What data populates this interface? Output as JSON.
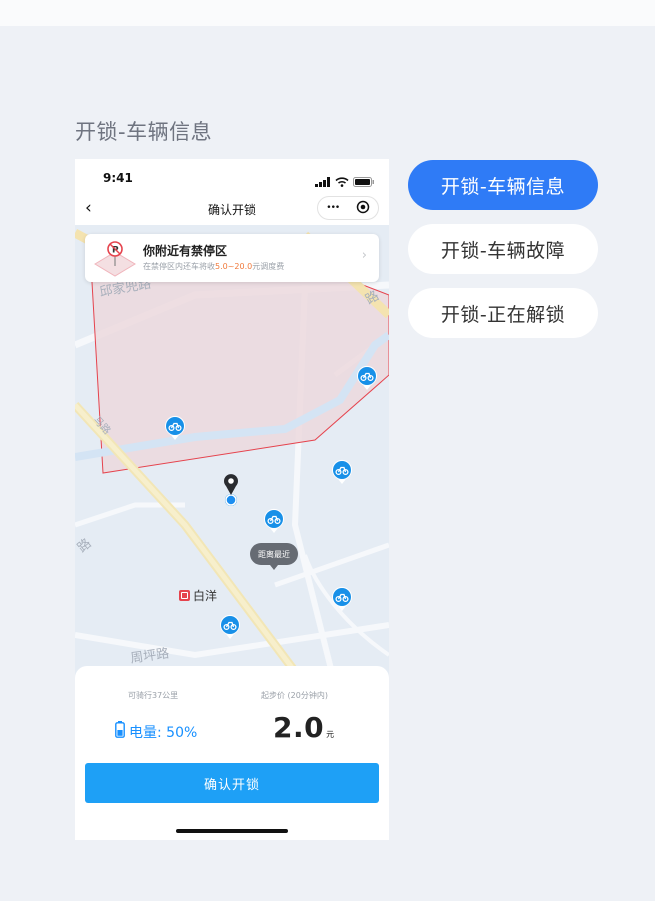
{
  "section_title": "开锁-车辆信息",
  "status_bar": {
    "time": "9:41"
  },
  "nav": {
    "back": "‹",
    "title": "确认开锁",
    "more_glyph": "•••"
  },
  "notice": {
    "title": "你附近有禁停区",
    "sub_prefix": "在禁停区内还车将收",
    "sub_highlight": "5.0~20.0",
    "sub_suffix": "元调度费",
    "arrow": "›"
  },
  "map": {
    "road_top": "邱家兜路",
    "road_top_right": "路",
    "road_left": "路",
    "road_bottom": "周坪路",
    "road_diagonal": "马路",
    "station_name": "白洋",
    "tooltip": "距离最近"
  },
  "sheet": {
    "range_label": "可骑行37公里",
    "price_label": "起步价 (20分钟内)",
    "battery_text": "电量: 50%",
    "battery_level": 0.5,
    "price_value": "2.0",
    "price_unit": "元",
    "confirm_label": "确认开锁"
  },
  "tabs": [
    {
      "label": "开锁-车辆信息",
      "active": true
    },
    {
      "label": "开锁-车辆故障",
      "active": false
    },
    {
      "label": "开锁-正在解锁",
      "active": false
    }
  ],
  "colors": {
    "primary": "#1ea0f6",
    "tab_active": "#2f7bf6",
    "no_parking_fill": "#ecd9dd",
    "no_parking_stroke": "#e5434d",
    "highlight": "#f07a3c"
  }
}
